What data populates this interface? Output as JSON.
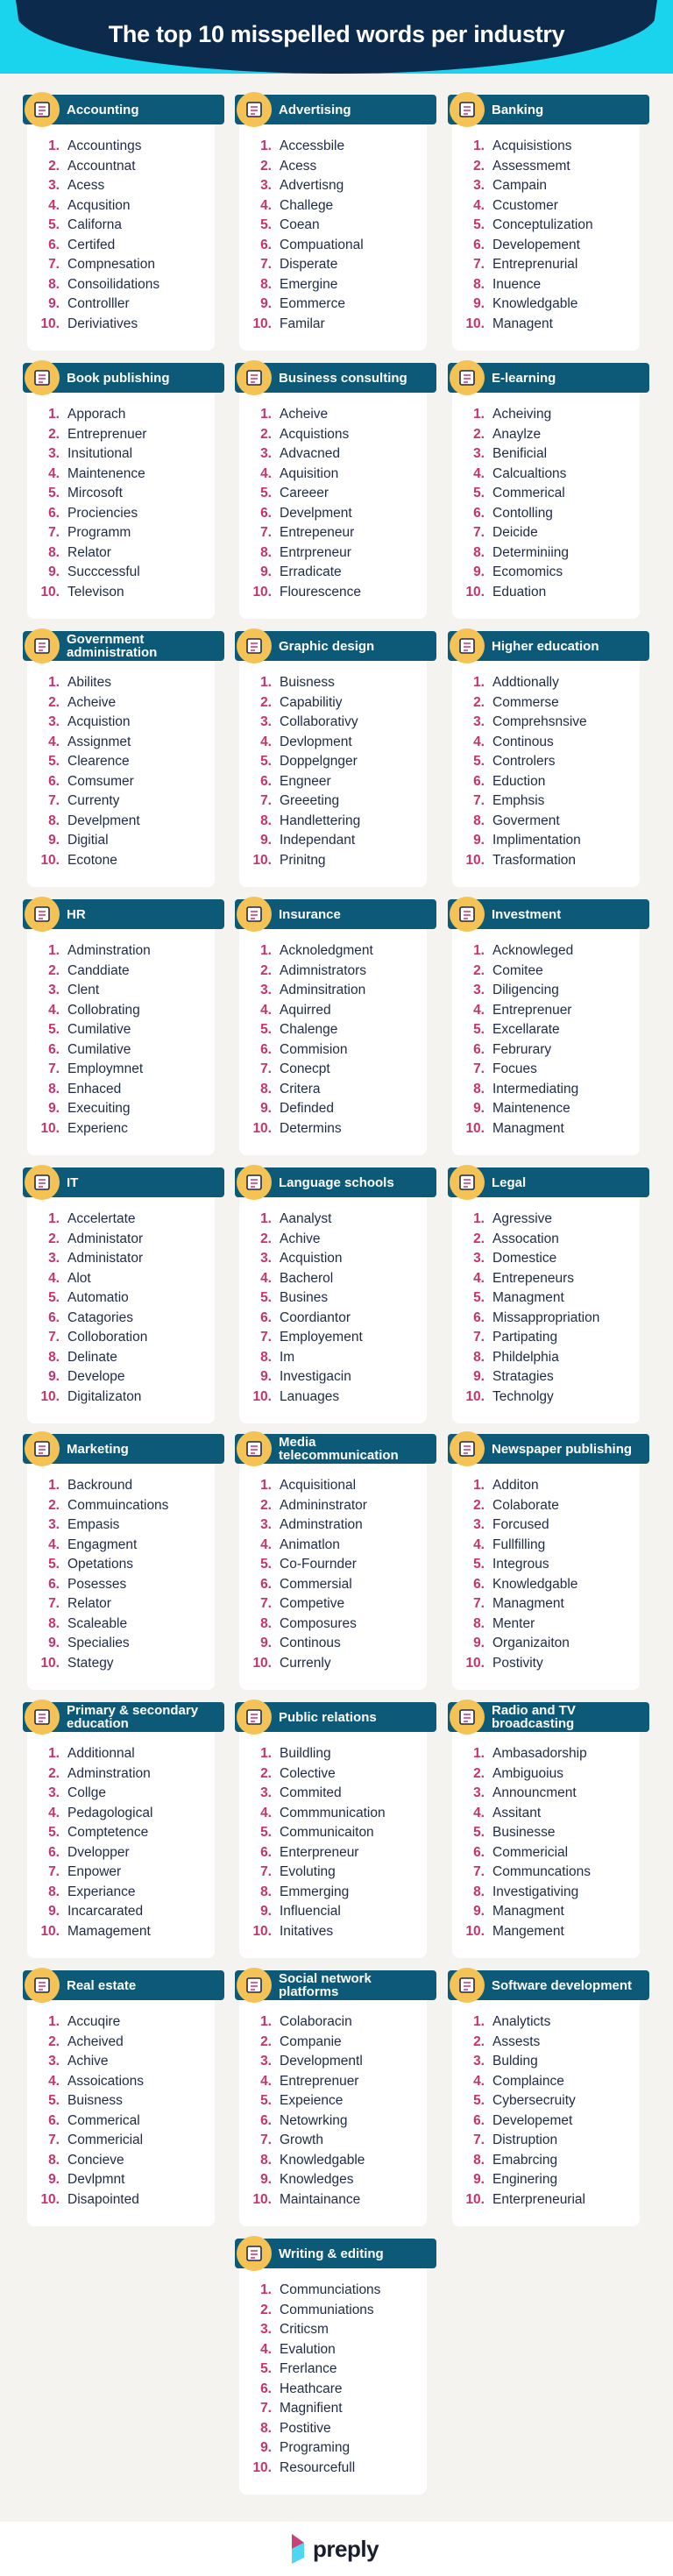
{
  "header": {
    "title": "The top 10 misspelled words per industry"
  },
  "colors": {
    "title_bg": "#0c2a4c",
    "title_accent": "#1ad3ec",
    "card_header": "#0d5a78",
    "icon_circle": "#f4c255",
    "number": "#c7336d",
    "word_text": "#1f2b45",
    "background": "#f4f3ef"
  },
  "industries": [
    {
      "name": "Accounting",
      "icon": "calculator-document-icon",
      "words": [
        "Accountings",
        "Accountnat",
        "Acess",
        "Acqusition",
        "Californa",
        "Certifed",
        "Compnesation",
        "Consoilidations",
        "Controlller",
        "Deriviatives"
      ]
    },
    {
      "name": "Advertising",
      "icon": "ad-click-icon",
      "words": [
        "Accessbile",
        "Acess",
        "Advertisng",
        "Challege",
        "Coean",
        "Compuational",
        "Disperate",
        "Emergine",
        "Eommerce",
        "Familar"
      ]
    },
    {
      "name": "Banking",
      "icon": "bank-building-icon",
      "words": [
        "Acquisistions",
        "Assessmemt",
        "Campain",
        "Ccustomer",
        "Conceptulization",
        "Developement",
        "Entreprenurial",
        "Inuence",
        "Knowledgable",
        "Managent"
      ]
    },
    {
      "name": "Book publishing",
      "icon": "books-icon",
      "words": [
        "Apporach",
        "Entreprenuer",
        "Insitutional",
        "Maintenence",
        "Mircosoft",
        "Prociencies",
        "Programm",
        "Relator",
        "Succcessful",
        "Televison"
      ]
    },
    {
      "name": "Business consulting",
      "icon": "consulting-idea-icon",
      "words": [
        "Acheive",
        "Acquistions",
        "Advacned",
        "Aquisition",
        "Careeer",
        "Develpment",
        "Entrepeneur",
        "Entrpreneur",
        "Erradicate",
        "Flourescence"
      ]
    },
    {
      "name": "E-learning",
      "icon": "online-learning-icon",
      "words": [
        "Acheiving",
        "Anaylze",
        "Benificial",
        "Calcualtions",
        "Commerical",
        "Contolling",
        "Deicide",
        "Determiniing",
        "Ecomomics",
        "Eduation"
      ]
    },
    {
      "name": "Government administration",
      "icon": "capitol-building-icon",
      "words": [
        "Abilites",
        "Acheive",
        "Acquistion",
        "Assignmet",
        "Clearence",
        "Comsumer",
        "Currenty",
        "Develpment",
        "Digitial",
        "Ecotone"
      ]
    },
    {
      "name": "Graphic design",
      "icon": "design-monitor-icon",
      "words": [
        "Buisness",
        "Capabilitiy",
        "Collaborativy",
        "Devlopment",
        "Doppelgnger",
        "Engneer",
        "Greeeting",
        "Handlettering",
        "Independant",
        "Prinitng"
      ]
    },
    {
      "name": "Higher education",
      "icon": "graduation-cap-icon",
      "words": [
        "Addtionally",
        "Commerse",
        "Comprehsnsive",
        "Continous",
        "Controlers",
        "Eduction",
        "Emphsis",
        "Goverment",
        "Implimentation",
        "Trasformation"
      ]
    },
    {
      "name": "HR",
      "icon": "people-network-icon",
      "words": [
        "Adminstration",
        "Canddiate",
        "Clent",
        "Collobrating",
        "Cumilative",
        "Cumilative",
        "Employmnet",
        "Enhaced",
        "Execuiting",
        "Experienc"
      ]
    },
    {
      "name": "Insurance",
      "icon": "shield-hands-icon",
      "words": [
        "Acknoledgment",
        "Adimnistrators",
        "Adminsitration",
        "Aquirred",
        "Chalenge",
        "Commision",
        "Conecpt",
        "Critera",
        "Definded",
        "Determins"
      ]
    },
    {
      "name": "Investment",
      "icon": "money-plant-icon",
      "words": [
        "Acknowleged",
        "Comitee",
        "Diligencing",
        "Entreprenuer",
        "Excellarate",
        "Februrary",
        "Focues",
        "Intermediating",
        "Maintenence",
        "Managment"
      ]
    },
    {
      "name": "IT",
      "icon": "computer-gear-icon",
      "words": [
        "Accelertate",
        "Administator",
        "Administator",
        "Alot",
        "Automatio",
        "Catagories",
        "Colloboration",
        "Delinate",
        "Develope",
        "Digitalizaton"
      ]
    },
    {
      "name": "Language schools",
      "icon": "speech-bubbles-icon",
      "words": [
        "Aanalyst",
        "Achive",
        "Acquistion",
        "Bacherol",
        "Busines",
        "Coordiantor",
        "Employement",
        "Im",
        "Investigacin",
        "Lanuages"
      ]
    },
    {
      "name": "Legal",
      "icon": "scales-icon",
      "words": [
        "Agressive",
        "Assocation",
        "Domestice",
        "Entrepeneurs",
        "Managment",
        "Missappropriation",
        "Partipating",
        "Phildelphia",
        "Stratagies",
        "Technolgy"
      ]
    },
    {
      "name": "Marketing",
      "icon": "megaphone-icon",
      "words": [
        "Backround",
        "Commuincations",
        "Empasis",
        "Engagment",
        "Opetations",
        "Posesses",
        "Relator",
        "Scaleable",
        "Specialies",
        "Stategy"
      ]
    },
    {
      "name": "Media telecommunication",
      "icon": "globe-network-icon",
      "words": [
        "Acquisitional",
        "Admininstrator",
        "Adminstration",
        "Animatlon",
        "Co-Fournder",
        "Commersial",
        "Competive",
        "Composures",
        "Continous",
        "Currenly"
      ]
    },
    {
      "name": "Newspaper publishing",
      "icon": "newspaper-icon",
      "words": [
        "Additon",
        "Colaborate",
        "Forcused",
        "Fullfilling",
        "Integrous",
        "Knowledgable",
        "Managment",
        "Menter",
        "Organizaiton",
        "Postivity"
      ]
    },
    {
      "name": "Primary & secondary education",
      "icon": "school-building-icon",
      "words": [
        "Additionnal",
        "Adminstration",
        "Collge",
        "Pedagological",
        "Comptetence",
        "Dvelopper",
        "Enpower",
        "Experiance",
        "Incarcarated",
        "Mamagement"
      ]
    },
    {
      "name": "Public relations",
      "icon": "handshake-people-icon",
      "words": [
        "Buildling",
        "Colective",
        "Commited",
        "Commmunication",
        "Communicaiton",
        "Enterpreneur",
        "Evoluting",
        "Emmerging",
        "Influencial",
        "Initatives"
      ]
    },
    {
      "name": "Radio and TV broadcasting",
      "icon": "broadcast-tower-icon",
      "words": [
        "Ambasadorship",
        "Ambiguoius",
        "Announcment",
        "Assitant",
        "Businesse",
        "Commericial",
        "Communcations",
        "Investigativing",
        "Managment",
        "Mangement"
      ]
    },
    {
      "name": "Real estate",
      "icon": "house-key-icon",
      "words": [
        "Accuqire",
        "Acheived",
        "Achive",
        "Assoications",
        "Buisness",
        "Commerical",
        "Commericial",
        "Concieve",
        "Devlpmnt",
        "Disapointed"
      ]
    },
    {
      "name": "Social network platforms",
      "icon": "social-media-icon",
      "words": [
        "Colaboracin",
        "Companie",
        "Developmentl",
        "Entreprenuer",
        "Expeience",
        "Netowrking",
        "Growth",
        "Knowledgable",
        "Knowledges",
        "Maintainance"
      ]
    },
    {
      "name": "Software development",
      "icon": "code-window-icon",
      "words": [
        "Analyticts",
        "Assests",
        "Bulding",
        "Complaince",
        "Cybersecruity",
        "Developemet",
        "Distruption",
        "Emabrcing",
        "Enginering",
        "Enterpreneurial"
      ]
    },
    {
      "name": "Writing & editing",
      "icon": "pencil-edit-icon",
      "words": [
        "Communciations",
        "Communiations",
        "Criticsm",
        "Evalution",
        "Frerlance",
        "Heathcare",
        "Magnifient",
        "Postitive",
        "Programing",
        "Resourcefull"
      ]
    }
  ],
  "footer": {
    "brand": "preply"
  }
}
